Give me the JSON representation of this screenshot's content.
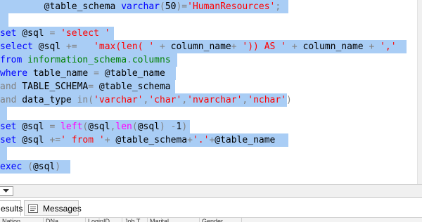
{
  "editor": {
    "lines": [
      {
        "segments": [
          [
            "txt",
            "        @table_schema "
          ],
          [
            "kw",
            "varchar"
          ],
          [
            "op",
            "("
          ],
          [
            "txt",
            "50"
          ],
          [
            "op",
            ")="
          ],
          [
            "str",
            "'HumanResources'"
          ],
          [
            "op",
            ";"
          ]
        ]
      },
      {
        "segments": []
      },
      {
        "segments": [
          [
            "kw",
            "set"
          ],
          [
            "txt",
            " @sql "
          ],
          [
            "op",
            "="
          ],
          [
            "txt",
            " "
          ],
          [
            "str",
            "'select '"
          ]
        ]
      },
      {
        "segments": [
          [
            "kw",
            "select"
          ],
          [
            "txt",
            " @sql "
          ],
          [
            "op",
            "+="
          ],
          [
            "txt",
            "   "
          ],
          [
            "str",
            "'max(len( '"
          ],
          [
            "txt",
            " "
          ],
          [
            "op",
            "+"
          ],
          [
            "txt",
            " column_name"
          ],
          [
            "op",
            "+"
          ],
          [
            "txt",
            " "
          ],
          [
            "str",
            "')) AS '"
          ],
          [
            "txt",
            " "
          ],
          [
            "op",
            "+"
          ],
          [
            "txt",
            " column_name "
          ],
          [
            "op",
            "+"
          ],
          [
            "txt",
            " "
          ],
          [
            "str",
            "','"
          ]
        ]
      },
      {
        "segments": [
          [
            "kw",
            "from"
          ],
          [
            "txt",
            " "
          ],
          [
            "sys",
            "information_schema"
          ],
          [
            "op",
            "."
          ],
          [
            "sys",
            "columns"
          ]
        ]
      },
      {
        "segments": [
          [
            "kw",
            "where"
          ],
          [
            "txt",
            " table_name "
          ],
          [
            "op",
            "="
          ],
          [
            "txt",
            " @table_name"
          ]
        ]
      },
      {
        "segments": [
          [
            "op",
            "and"
          ],
          [
            "txt",
            " TABLE_SCHEMA"
          ],
          [
            "op",
            "="
          ],
          [
            "txt",
            " @table_schema"
          ]
        ]
      },
      {
        "segments": [
          [
            "op",
            "and"
          ],
          [
            "txt",
            " data_type "
          ],
          [
            "op",
            "in("
          ],
          [
            "str",
            "'varchar'"
          ],
          [
            "op",
            ","
          ],
          [
            "str",
            "'char'"
          ],
          [
            "op",
            ","
          ],
          [
            "str",
            "'nvarchar'"
          ],
          [
            "op",
            ","
          ],
          [
            "str",
            "'nchar'"
          ],
          [
            "op",
            ")"
          ]
        ]
      },
      {
        "segments": []
      },
      {
        "segments": [
          [
            "kw",
            "set"
          ],
          [
            "txt",
            " @sql "
          ],
          [
            "op",
            "="
          ],
          [
            "txt",
            " "
          ],
          [
            "fn",
            "left"
          ],
          [
            "op",
            "("
          ],
          [
            "txt",
            "@sql"
          ],
          [
            "op",
            ","
          ],
          [
            "fn",
            "len"
          ],
          [
            "op",
            "("
          ],
          [
            "txt",
            "@sql"
          ],
          [
            "op",
            ")"
          ],
          [
            "txt",
            " "
          ],
          [
            "op",
            "-"
          ],
          [
            "txt",
            "1"
          ],
          [
            "op",
            ")"
          ]
        ]
      },
      {
        "segments": [
          [
            "kw",
            "set"
          ],
          [
            "txt",
            " @sql "
          ],
          [
            "op",
            "+="
          ],
          [
            "str",
            "' from '"
          ],
          [
            "op",
            "+"
          ],
          [
            "txt",
            " @table_schema"
          ],
          [
            "op",
            "+"
          ],
          [
            "str",
            "'.'"
          ],
          [
            "op",
            "+"
          ],
          [
            "txt",
            "@table_name"
          ]
        ]
      },
      {
        "segments": []
      },
      {
        "segments": [
          [
            "kw",
            "exec"
          ],
          [
            "txt",
            " "
          ],
          [
            "op",
            "("
          ],
          [
            "txt",
            "@sql"
          ],
          [
            "op",
            ")"
          ]
        ]
      }
    ]
  },
  "bottom_tabs": {
    "results_label": "esults",
    "messages_label": "Messages"
  },
  "grid_headers": [
    "Nation...",
    "DNa...",
    "LoginID",
    "Job T...",
    "Marital...",
    "Gender"
  ]
}
